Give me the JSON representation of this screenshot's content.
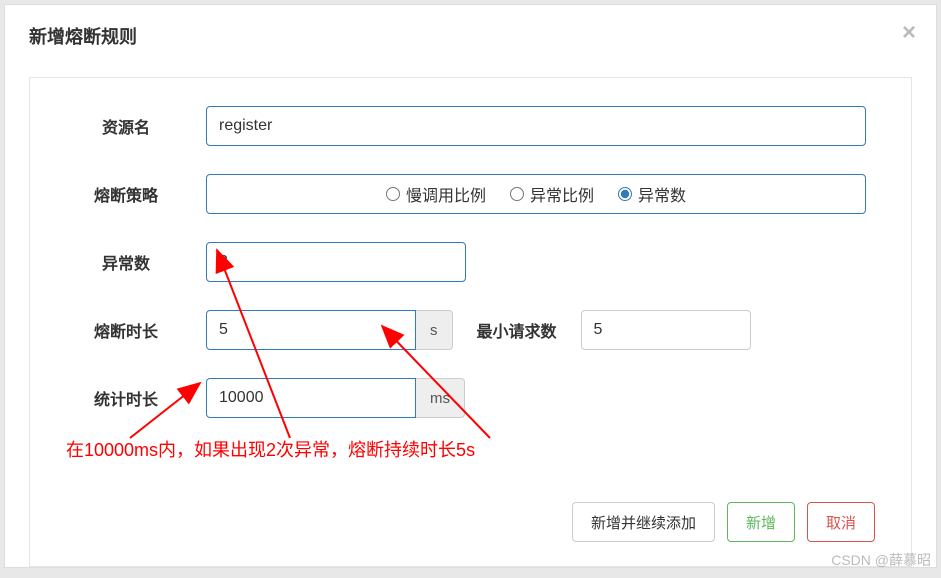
{
  "title": "新增熔断规则",
  "labels": {
    "resource": "资源名",
    "strategy": "熔断策略",
    "exceptionCount": "异常数",
    "fuseDuration": "熔断时长",
    "minRequests": "最小请求数",
    "statsDuration": "统计时长"
  },
  "values": {
    "resource": "register",
    "exceptionCount": "2",
    "fuseDuration": "5",
    "minRequests": "5",
    "statsDuration": "10000"
  },
  "units": {
    "seconds": "s",
    "milliseconds": "ms"
  },
  "radioOptions": {
    "slowCall": "慢调用比例",
    "exceptionRatio": "异常比例",
    "exceptionCount": "异常数"
  },
  "radioSelected": "exceptionCount",
  "annotation": "在10000ms内，如果出现2次异常，熔断持续时长5s",
  "buttons": {
    "addContinue": "新增并继续添加",
    "add": "新增",
    "cancel": "取消"
  },
  "watermark": "CSDN @薛慕昭"
}
